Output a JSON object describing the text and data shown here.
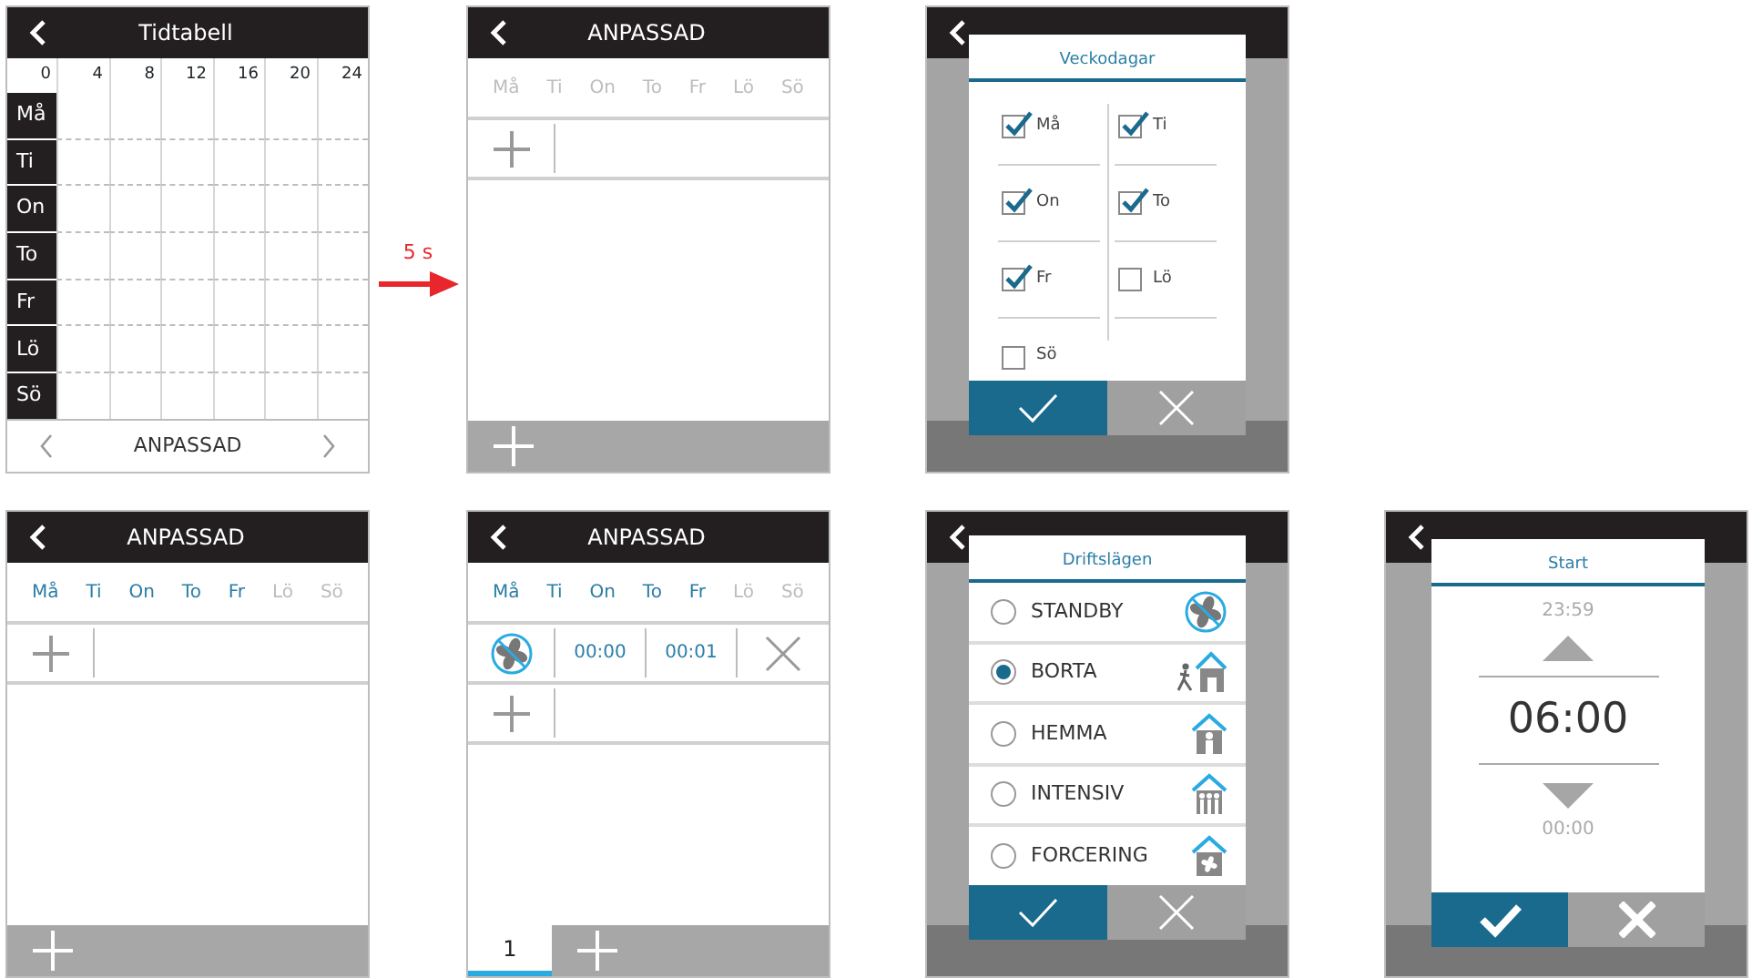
{
  "screens": [
    {
      "kind": "schedule",
      "title": "Tidtabell",
      "hours": [
        "0",
        "4",
        "8",
        "12",
        "16",
        "20",
        "24"
      ],
      "days": [
        "Må",
        "Ti",
        "On",
        "To",
        "Fr",
        "Lö",
        "Sö"
      ],
      "footer": "ANPASSAD"
    },
    {
      "kind": "program",
      "title": "ANPASSAD",
      "days": [
        {
          "label": "Må",
          "active": false
        },
        {
          "label": "Ti",
          "active": false
        },
        {
          "label": "On",
          "active": false
        },
        {
          "label": "To",
          "active": false
        },
        {
          "label": "Fr",
          "active": false
        },
        {
          "label": "Lö",
          "active": false
        },
        {
          "label": "Sö",
          "active": false
        }
      ]
    },
    {
      "kind": "weekday_dialog",
      "title": "Veckodagar",
      "options": [
        {
          "label": "Må",
          "checked": true
        },
        {
          "label": "Ti",
          "checked": true
        },
        {
          "label": "On",
          "checked": true
        },
        {
          "label": "To",
          "checked": true
        },
        {
          "label": "Fr",
          "checked": true
        },
        {
          "label": "Lö",
          "checked": false
        },
        {
          "label": "Sö",
          "checked": false
        }
      ]
    },
    {
      "kind": "program",
      "title": "ANPASSAD",
      "days": [
        {
          "label": "Må",
          "active": true
        },
        {
          "label": "Ti",
          "active": true
        },
        {
          "label": "On",
          "active": true
        },
        {
          "label": "To",
          "active": true
        },
        {
          "label": "Fr",
          "active": true
        },
        {
          "label": "Lö",
          "active": false
        },
        {
          "label": "Sö",
          "active": false
        }
      ]
    },
    {
      "kind": "program",
      "title": "ANPASSAD",
      "days": [
        {
          "label": "Må",
          "active": true
        },
        {
          "label": "Ti",
          "active": true
        },
        {
          "label": "On",
          "active": true
        },
        {
          "label": "To",
          "active": true
        },
        {
          "label": "Fr",
          "active": true
        },
        {
          "label": "Lö",
          "active": false
        },
        {
          "label": "Sö",
          "active": false
        }
      ],
      "entries": [
        {
          "start": "00:00",
          "end": "00:01"
        }
      ],
      "tabs": [
        {
          "label": "1",
          "selected": true
        }
      ]
    },
    {
      "kind": "mode_dialog",
      "title": "Driftslägen",
      "modes": [
        {
          "label": "STANDBY",
          "selected": false,
          "kind": "fan"
        },
        {
          "label": "BORTA",
          "selected": true,
          "kind": "away"
        },
        {
          "label": "HEMMA",
          "selected": false,
          "kind": "home"
        },
        {
          "label": "INTENSIV",
          "selected": false,
          "kind": "crowd"
        },
        {
          "label": "FORCERING",
          "selected": false,
          "kind": "boost"
        }
      ]
    },
    {
      "kind": "time_dialog",
      "title": "Start",
      "previous": "23:59",
      "value": "06:00",
      "next": "00:00"
    }
  ],
  "transition": {
    "label": "5 s"
  }
}
